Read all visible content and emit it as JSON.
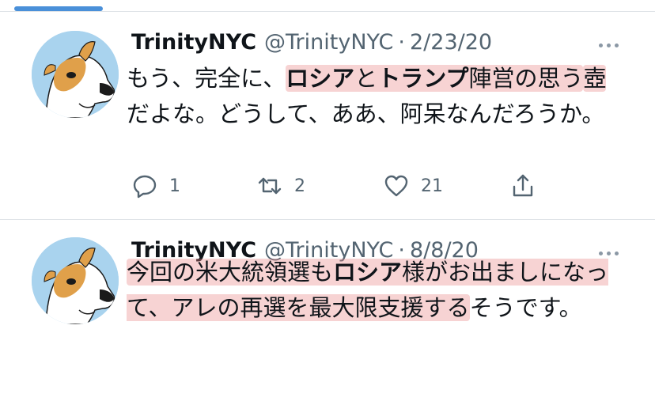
{
  "tweets": [
    {
      "name": "TrinityNYC",
      "handle": "@TrinityNYC",
      "separator": "·",
      "date": "2/23/20",
      "text": {
        "seg1": "もう、完全に、",
        "seg2_bold": "ロシア",
        "seg3": "と",
        "seg4_bold": "トランプ",
        "seg5": "陣営の思う",
        "seg6": "壺",
        "seg7": "だよな。どうして、ああ、阿呆なんだろうか。"
      },
      "stats": {
        "replies": "1",
        "retweets": "2",
        "likes": "21"
      }
    },
    {
      "name": "TrinityNYC",
      "handle": "@TrinityNYC",
      "separator": "·",
      "date": "8/8/20",
      "text": {
        "seg1": "今回の米大統領選も",
        "seg2_bold": "ロシア",
        "seg3": "様がお出ましに",
        "seg4": "なって、アレの再選を最大限支援する",
        "seg5": "そうです。"
      }
    }
  ],
  "icons": {
    "reply": "speech-bubble-icon",
    "retweet": "retweet-icon",
    "like": "heart-icon",
    "share": "share-icon",
    "more": "more-dots-icon"
  },
  "colors": {
    "highlight": "#e78282",
    "secondary_text": "#536471",
    "accent_bar": "#4a90d9",
    "avatar_bg": "#a9d3ee"
  }
}
